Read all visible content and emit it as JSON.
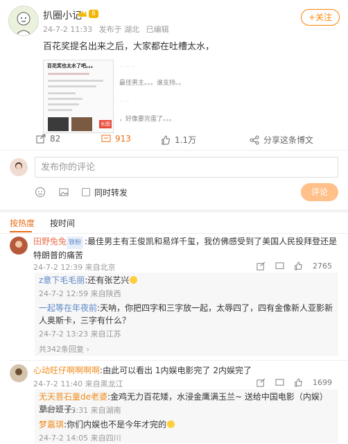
{
  "post": {
    "author": "扒圈小记",
    "level_badge": "8",
    "time": "24-7-2 11:33",
    "location": "发布于 湖北",
    "edited": "已编辑",
    "follow_label": "+关注",
    "text": "百花奖提名出来之后，大家都在吐槽太水，",
    "thumb_title": "百花奖也太水了吧。。。",
    "thumb_badge": "长图",
    "side_snippets": [
      "最佳男主。。。谁支持。。",
      "，好像要完蛋了。。。"
    ],
    "actions": {
      "repost_count": "82",
      "comment_count": "913",
      "like_count": "1.1万",
      "share_label": "分享这条博文"
    }
  },
  "composer": {
    "placeholder": "发布你的评论",
    "repost_label": "同时转发",
    "submit_label": "评论"
  },
  "tabs": {
    "hot": "按热度",
    "time": "按时间"
  },
  "comments": [
    {
      "user": "田野兔兔",
      "tag": "铁粉",
      "text": "最佳男主有王俊凯和易烊千玺，我仿佛感受到了美国人民投拜登还是特朗普的痛苦",
      "meta": "24-7-2 12:39 来自北京",
      "likes": "2765",
      "replies": [
        {
          "user": "z意下毛毛丽",
          "text": "还有张艺兴",
          "meta": "24-7-2 12:59 来自陕西"
        },
        {
          "user": "一起等在年夜前",
          "text": "天呐，你把四字和三字放一起，太辱四了，四有金像新人亚影新人奥斯卡，三字有什么？",
          "meta": "24-7-2 13:23 来自江苏"
        }
      ],
      "more": "共342条回复"
    },
    {
      "user": "心动旺仔啊啊啊啊",
      "text": "由此可以看出 1内娱电影完了 2内娱完了",
      "meta": "24-7-2 11:40 来自黑龙江",
      "likes": "1699",
      "replies": [
        {
          "user": "无天菩石童de老婆",
          "text": "金鸡无力百花矮，水浸金鹰满玉兰~ 送给中国电影（内娱）草台班子，",
          "meta": "24-7-2 13:31 来自湖南"
        },
        {
          "user": "梦嘉琪",
          "text": "你们内娱也不是今年才完的",
          "meta": "24-7-2 14:05 来自四川"
        }
      ]
    }
  ]
}
